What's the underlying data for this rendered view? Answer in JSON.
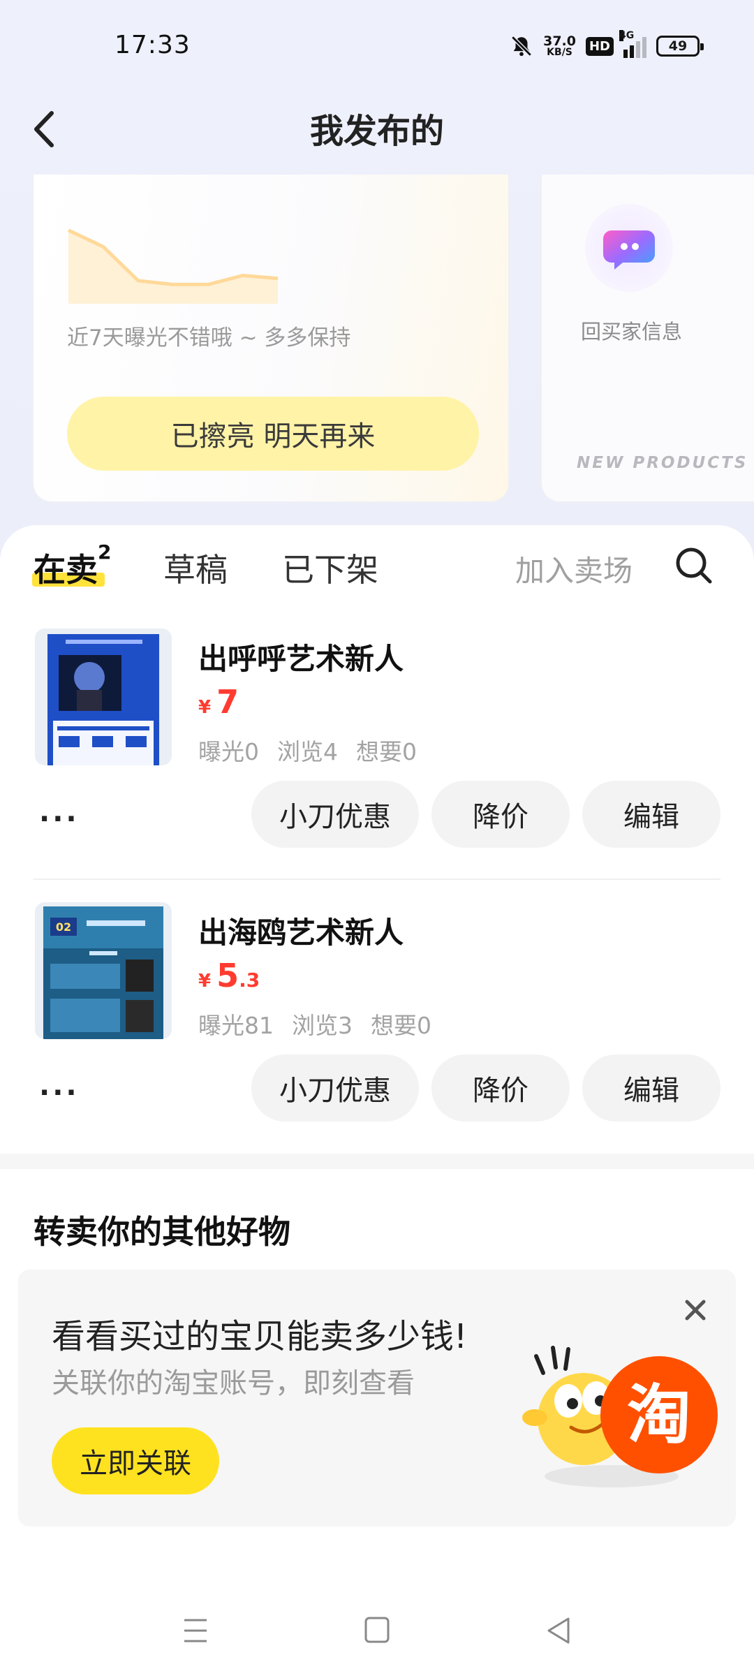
{
  "status_bar": {
    "time": "17:33",
    "net_speed_value": "37.0",
    "net_speed_unit": "KB/S",
    "hd_label": "HD",
    "network_label": "4G",
    "battery_level": "49"
  },
  "header": {
    "title": "我发布的"
  },
  "exposure_card": {
    "note": "近7天曝光不错哦 ~ 多多保持",
    "button_label": "已擦亮 明天再来",
    "trend_values": [
      0.92,
      0.7,
      0.25,
      0.2,
      0.2,
      0.32,
      0.28
    ]
  },
  "reply_card": {
    "label": "回买家信息",
    "banner_text": "NEW PRODUCTS CO"
  },
  "tabs": {
    "on_sale_label": "在卖",
    "on_sale_count": "2",
    "drafts_label": "草稿",
    "removed_label": "已下架",
    "join_market_label": "加入卖场"
  },
  "items": [
    {
      "title": "出呼呼艺术新人",
      "price_symbol": "¥",
      "price_int": "7",
      "price_dec": "",
      "exposure": "曝光0",
      "views": "浏览4",
      "wants": "想要0",
      "more": "···",
      "coupon_label": "小刀优惠",
      "reduce_label": "降价",
      "edit_label": "编辑"
    },
    {
      "title": "出海鸥艺术新人",
      "price_symbol": "¥",
      "price_int": "5",
      "price_dec": ".3",
      "exposure": "曝光81",
      "views": "浏览3",
      "wants": "想要0",
      "more": "···",
      "coupon_label": "小刀优惠",
      "reduce_label": "降价",
      "edit_label": "编辑",
      "thumb_badge": "02"
    }
  ],
  "resell": {
    "title": "转卖你的其他好物",
    "promo_title": "看看买过的宝贝能卖多少钱!",
    "promo_sub": "关联你的淘宝账号，即刻查看",
    "promo_button": "立即关联",
    "mascot_char": "淘"
  },
  "colors": {
    "accent_yellow": "#ffe21f",
    "price_red": "#ff3b30",
    "taobao_orange": "#ff5000"
  }
}
